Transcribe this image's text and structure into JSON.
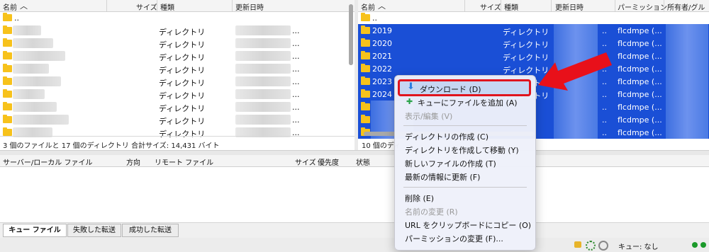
{
  "left_pane": {
    "headers": {
      "name": "名前",
      "size": "サイズ",
      "type": "種類",
      "modified": "更新日時"
    },
    "parent_row": "..",
    "rows": [
      {
        "type": "ディレクトリ",
        "modified_suffix": "..."
      },
      {
        "type": "ディレクトリ",
        "modified_suffix": "..."
      },
      {
        "type": "ディレクトリ",
        "modified_suffix": "..."
      },
      {
        "type": "ディレクトリ",
        "modified_suffix": "..."
      },
      {
        "type": "ディレクトリ",
        "modified_suffix": "..."
      },
      {
        "type": "ディレクトリ",
        "modified_suffix": "..."
      },
      {
        "type": "ディレクトリ",
        "modified_suffix": "..."
      },
      {
        "type": "ディレクトリ",
        "modified_suffix": "..."
      },
      {
        "type": "ディレクトリ",
        "modified_suffix": "..."
      }
    ],
    "status": "3 個のファイルと 17 個のディレクトリ 合計サイズ: 14,431 バイト"
  },
  "right_pane": {
    "headers": {
      "name": "名前",
      "size": "サイズ",
      "type": "種類",
      "modified": "更新日時",
      "permission": "パーミッション",
      "owner": "所有者/グル"
    },
    "parent_row": "..",
    "rows": [
      {
        "name": "2019",
        "type": "ディレクトリ",
        "dots": "..",
        "permission": "flcdmpe (..."
      },
      {
        "name": "2020",
        "type": "ディレクトリ",
        "dots": "..",
        "permission": "flcdmpe (..."
      },
      {
        "name": "2021",
        "type": "ディレクトリ",
        "dots": "..",
        "permission": "flcdmpe (..."
      },
      {
        "name": "2022",
        "type": "ディレクトリ",
        "dots": "..",
        "permission": "flcdmpe (..."
      },
      {
        "name": "2023",
        "type": "ディレクトリ",
        "dots": "..",
        "permission": "flcdmpe (..."
      },
      {
        "name": "2024",
        "type": "ディレクトリ",
        "dots": "..",
        "permission": "flcdmpe (..."
      },
      {
        "name": "",
        "type": "",
        "dots": "..",
        "permission": "flcdmpe (..."
      },
      {
        "name": "",
        "type": "",
        "dots": "..",
        "permission": "flcdmpe (..."
      },
      {
        "name": "",
        "type": "",
        "dots": "..",
        "permission": "flcdmpe (..."
      }
    ],
    "status": "10 個のディ"
  },
  "queue": {
    "headers": {
      "server_local": "サーバー/ローカル ファイル",
      "direction": "方向",
      "remote": "リモート ファイル",
      "size": "サイズ",
      "priority": "優先度",
      "state": "状態"
    },
    "tabs": [
      "キュー ファイル",
      "失敗した転送",
      "成功した転送"
    ]
  },
  "footer": {
    "queue_status": "キュー: なし"
  },
  "context_menu": {
    "download": "ダウンロード (D)",
    "add_queue": "キューにファイルを追加 (A)",
    "view_edit": "表示/編集 (V)",
    "create_dir": "ディレクトリの作成 (C)",
    "create_dir_move": "ディレクトリを作成して移動 (Y)",
    "new_file": "新しいファイルの作成 (T)",
    "refresh": "最新の情報に更新 (F)",
    "delete": "削除 (E)",
    "rename": "名前の変更 (R)",
    "copy_url": "URL をクリップボードにコピー (O)",
    "permissions": "パーミッションの変更 (F)..."
  },
  "colors": {
    "selection": "#1a4fd6",
    "highlight_border": "#e0141e",
    "arrow": "#e8101a",
    "folder": "#f7c21b"
  }
}
